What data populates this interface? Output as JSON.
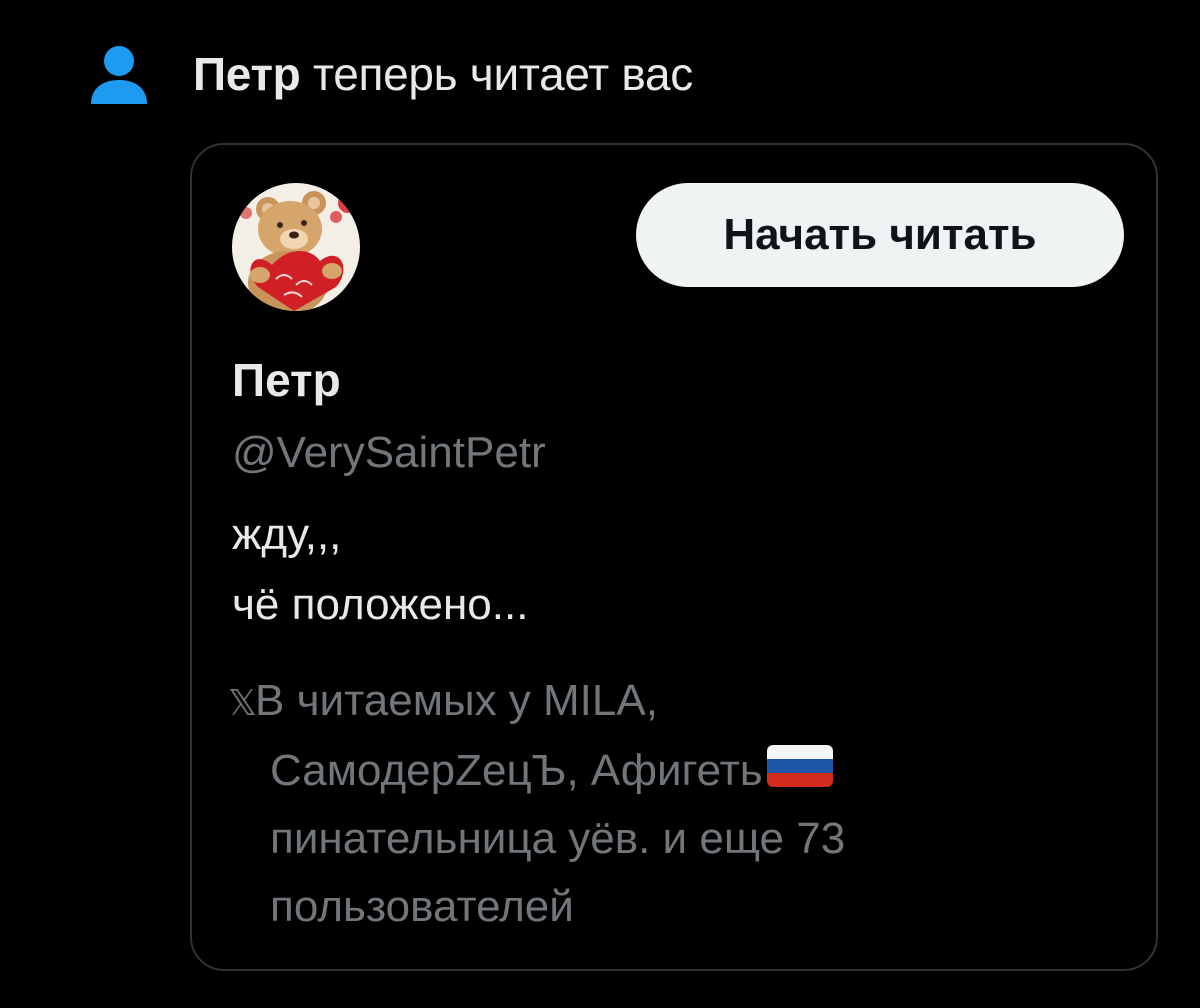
{
  "notification": {
    "icon": "person-icon",
    "icon_color": "#1d9bf0",
    "user_name": "Петр",
    "action_text": " теперь читает вас"
  },
  "profile_card": {
    "avatar": "teddy-bear-avatar",
    "follow_button_label": "Начать читать",
    "display_name": "Петр",
    "handle": "@VerySaintPetr",
    "bio_lines": [
      "жду,,,",
      "чё положено..."
    ],
    "followed_by": {
      "icon_glyph": "𝕏",
      "line1": "В читаемых у MILA,",
      "line2": "СамодерZецЪ, Афигеть",
      "line2_emoji": "russia-flag",
      "line3": "пинательница уёв. и еще 73",
      "line4": "пользователей"
    }
  },
  "colors": {
    "background": "#000000",
    "primary_text": "#e7e9ea",
    "secondary_text": "#71767b",
    "border": "#2f3336",
    "button_bg": "#eff3f4",
    "button_text": "#0f1419"
  }
}
